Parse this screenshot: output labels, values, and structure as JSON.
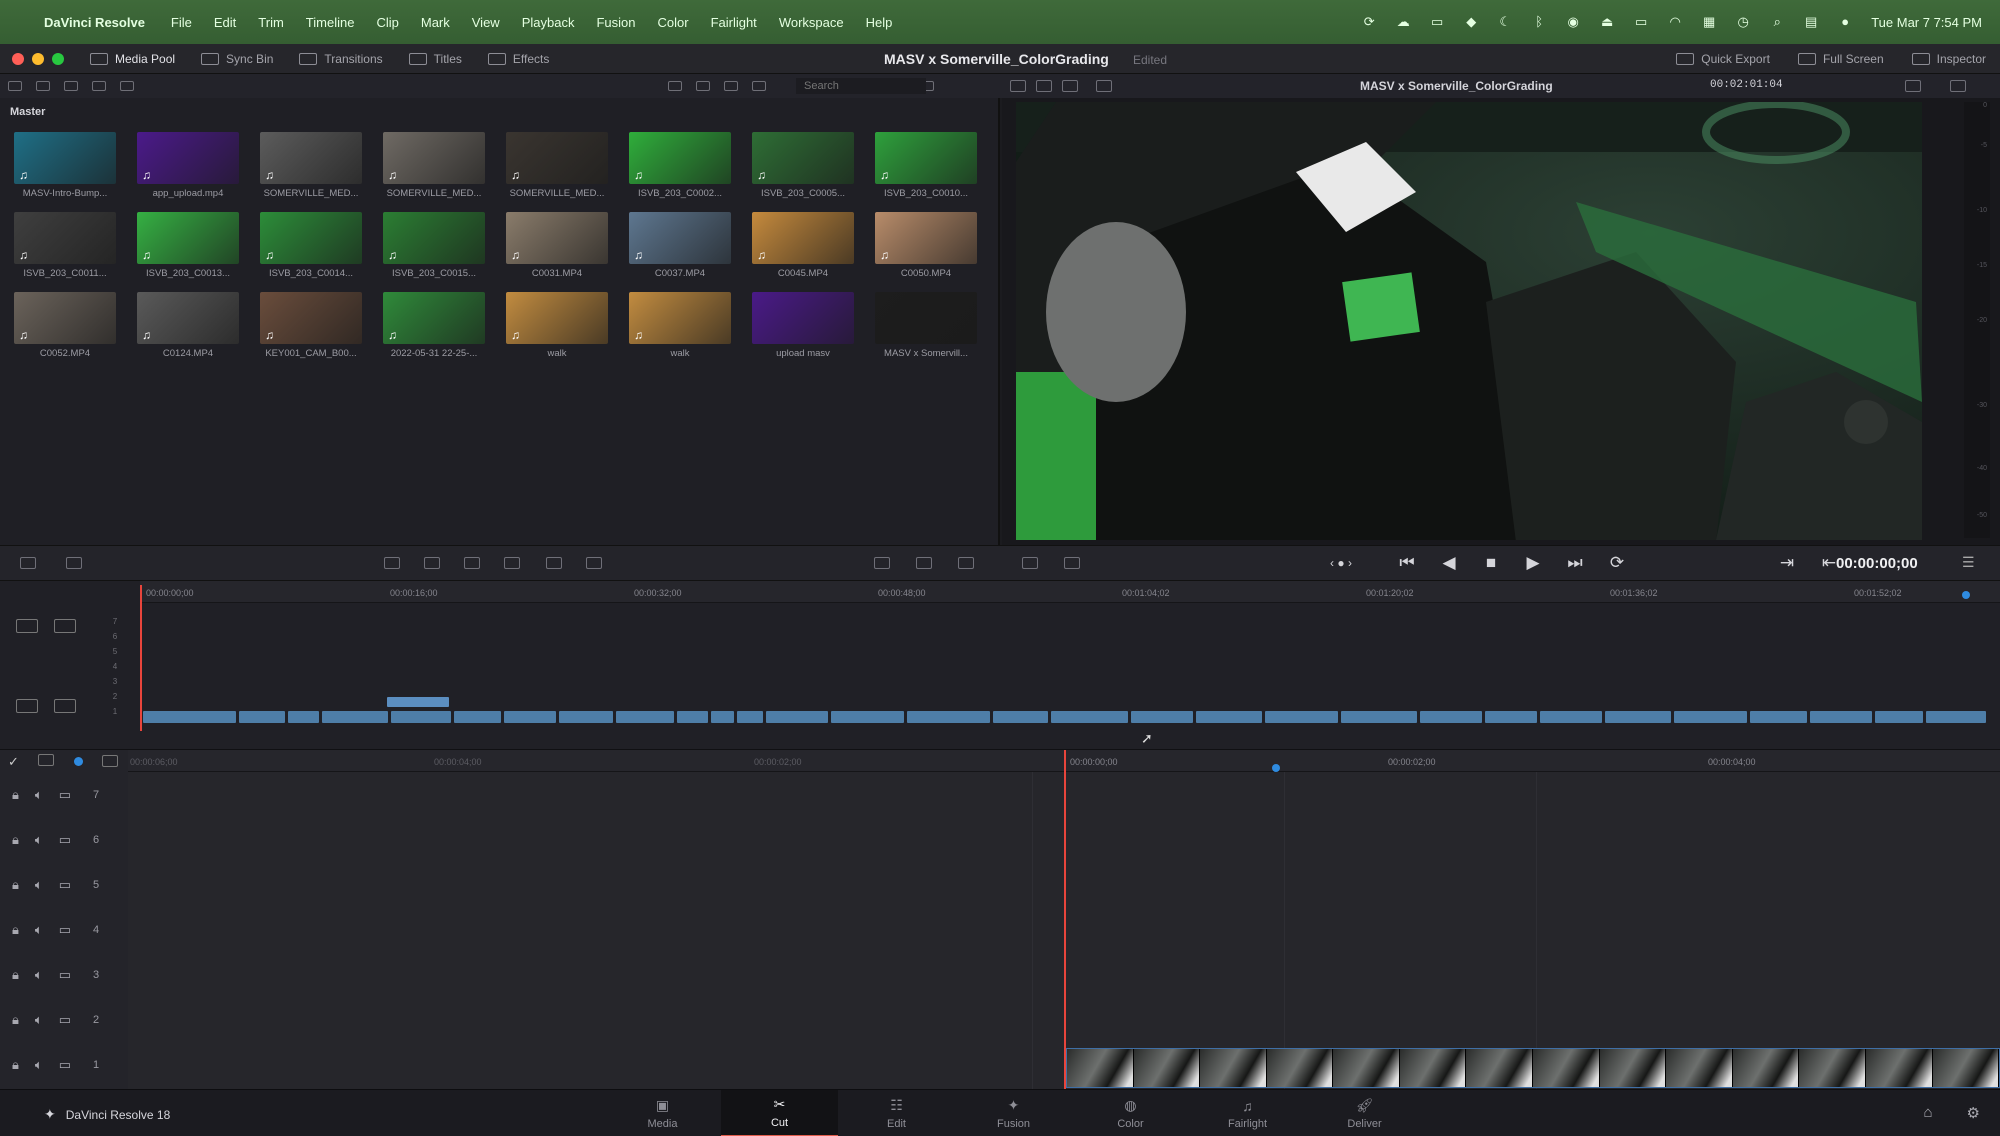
{
  "menubar": {
    "app": "DaVinci Resolve",
    "items": [
      "File",
      "Edit",
      "Trim",
      "Timeline",
      "Clip",
      "Mark",
      "View",
      "Playback",
      "Fusion",
      "Color",
      "Fairlight",
      "Workspace",
      "Help"
    ],
    "clock": "Tue Mar 7  7:54 PM"
  },
  "titlebar": {
    "media_pool": "Media Pool",
    "sync_bin": "Sync Bin",
    "transitions": "Transitions",
    "titles": "Titles",
    "effects": "Effects",
    "project_title": "MASV x Somerville_ColorGrading",
    "edited": "Edited",
    "quick_export": "Quick Export",
    "full_screen": "Full Screen",
    "inspector": "Inspector"
  },
  "media_pool": {
    "search_placeholder": "Search",
    "bin": "Master",
    "clips": [
      {
        "label": "MASV-Intro-Bump...",
        "color": "#1f6f86",
        "audio": true
      },
      {
        "label": "app_upload.mp4",
        "color": "#4b1a8a",
        "audio": true
      },
      {
        "label": "SOMERVILLE_MED...",
        "color": "#5c5c5c",
        "audio": true
      },
      {
        "label": "SOMERVILLE_MED...",
        "color": "#6f6a64",
        "audio": true
      },
      {
        "label": "SOMERVILLE_MED...",
        "color": "#3a3530",
        "audio": true
      },
      {
        "label": "ISVB_203_C0002...",
        "color": "#2fae3b",
        "audio": true
      },
      {
        "label": "ISVB_203_C0005...",
        "color": "#2e6e35",
        "audio": true
      },
      {
        "label": "ISVB_203_C0010...",
        "color": "#2ea03c",
        "audio": true
      },
      {
        "label": "ISVB_203_C0011...",
        "color": "#3f3f3f",
        "audio": true
      },
      {
        "label": "ISVB_203_C0013...",
        "color": "#35b043",
        "audio": true
      },
      {
        "label": "ISVB_203_C0014...",
        "color": "#2c8d39",
        "audio": true
      },
      {
        "label": "ISVB_203_C0015...",
        "color": "#2b7e33",
        "audio": true
      },
      {
        "label": "C0031.MP4",
        "color": "#8a7c6b",
        "audio": true
      },
      {
        "label": "C0037.MP4",
        "color": "#5e7790",
        "audio": true
      },
      {
        "label": "C0045.MP4",
        "color": "#c58a3d",
        "audio": true
      },
      {
        "label": "C0050.MP4",
        "color": "#b88c6a",
        "audio": true
      },
      {
        "label": "C0052.MP4",
        "color": "#6b635b",
        "audio": true
      },
      {
        "label": "C0124.MP4",
        "color": "#5a5a5a",
        "audio": true
      },
      {
        "label": "KEY001_CAM_B00...",
        "color": "#6a4d3c",
        "audio": true
      },
      {
        "label": "2022-05-31 22-25-...",
        "color": "#2f8a3a",
        "audio": true
      },
      {
        "label": "walk",
        "color": "#c28c40",
        "audio": true
      },
      {
        "label": "walk",
        "color": "#c28c40",
        "audio": true
      },
      {
        "label": "upload masv",
        "color": "#4a1a88",
        "audio": false
      },
      {
        "label": "MASV x Somervill...",
        "color": "#1d1d1d",
        "audio": false
      }
    ]
  },
  "viewer": {
    "clip_name": "MASV x Somerville_ColorGrading",
    "source_timecode": "00:02:01:04",
    "record_timecode": "00:00:00;00",
    "meter_ticks": [
      "0",
      "-5",
      "-10",
      "-15",
      "-20",
      "-30",
      "-40",
      "-50"
    ]
  },
  "upper_timeline": {
    "ruler": [
      "00:00:00;00",
      "00:00:16;00",
      "00:00:32;00",
      "00:00:48;00",
      "00:01:04;02",
      "00:01:20;02",
      "00:01:36;02",
      "00:01:52;02"
    ],
    "track_numbers": [
      "7",
      "6",
      "5",
      "4",
      "3",
      "2",
      "1"
    ]
  },
  "lower_timeline": {
    "ruler": [
      "00:00:06;00",
      "00:00:04;00",
      "00:00:02;00",
      "00:00:00;00",
      "00:00:02;00",
      "00:00:04;00"
    ],
    "tracks": [
      "7",
      "6",
      "5",
      "4",
      "3",
      "2",
      "1"
    ]
  },
  "pagebar": {
    "brand": "DaVinci Resolve 18",
    "pages": [
      {
        "label": "Media",
        "icon": "media-icon"
      },
      {
        "label": "Cut",
        "icon": "cut-icon"
      },
      {
        "label": "Edit",
        "icon": "edit-icon"
      },
      {
        "label": "Fusion",
        "icon": "fusion-icon"
      },
      {
        "label": "Color",
        "icon": "color-icon"
      },
      {
        "label": "Fairlight",
        "icon": "fairlight-icon"
      },
      {
        "label": "Deliver",
        "icon": "deliver-icon"
      }
    ],
    "active_page": "Cut"
  },
  "colors": {
    "playhead": "#e8453c",
    "clip_blue": "#4e7ea8",
    "menubar_green": "#3f6a3a"
  }
}
